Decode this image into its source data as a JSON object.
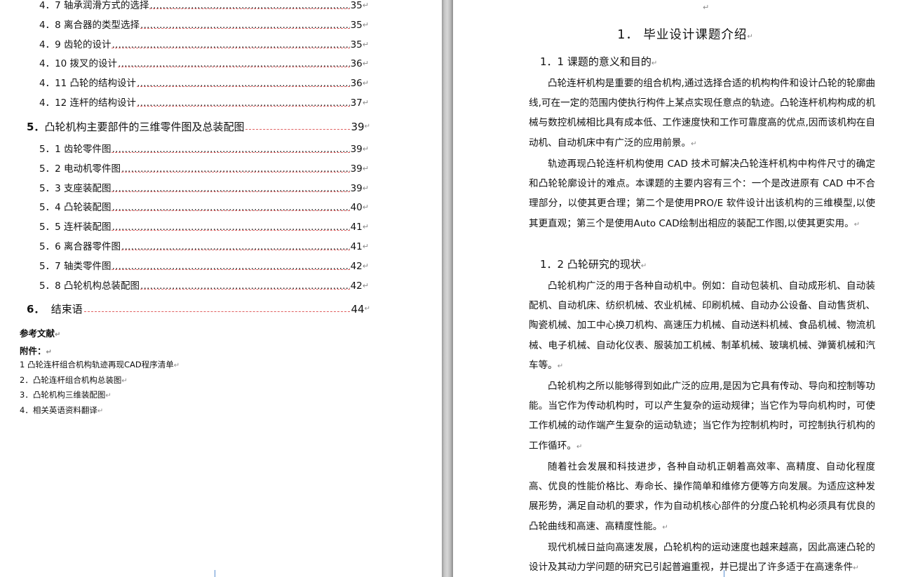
{
  "left_page": {
    "toc_items": [
      {
        "label": "4．7 轴承润滑方式的选择",
        "page": "35"
      },
      {
        "label": "4．8 离合器的类型选择",
        "page": "35"
      },
      {
        "label": "4．9 齿轮的设计",
        "page": "35"
      },
      {
        "label": "4．10 拨叉的设计",
        "page": "36"
      },
      {
        "label": "4．11 凸轮的结构设计",
        "page": "36"
      },
      {
        "label": "4．12 连杆的结构设计",
        "page": "37"
      }
    ],
    "chapter5": {
      "number": "5．",
      "title": "凸轮机构主要部件的三维零件图及总装配图",
      "page": "39"
    },
    "chapter5_items": [
      {
        "label": "5．1 齿轮零件图",
        "page": "39"
      },
      {
        "label": "5．2 电动机零件图",
        "page": "39"
      },
      {
        "label": "5．3 支座装配图",
        "page": "39"
      },
      {
        "label": "5．4 凸轮装配图",
        "page": "40"
      },
      {
        "label": "5．5 连杆装配图",
        "page": "41"
      },
      {
        "label": "5．6 离合器零件图",
        "page": "41"
      },
      {
        "label": "5．7 轴类零件图",
        "page": "42"
      },
      {
        "label": "5．8 凸轮机构总装配图",
        "page": "42"
      }
    ],
    "chapter6": {
      "number": "6．",
      "title": "结束语",
      "page": "44"
    },
    "references": "参考文献",
    "attachments_label": "附件：",
    "attachments": [
      "1 凸轮连杆组合机构轨迹再现CAD程序清单",
      "2．凸轮连杆组合机构总装图",
      "3．凸轮机构三维装配图",
      "4．相关英语资料翻译"
    ],
    "dots": "……………………………………………………………………………………"
  },
  "right_page": {
    "chapter_title": "1． 毕业设计课题介绍",
    "section1": "1．1 课题的意义和目的",
    "section1_paras": [
      "凸轮连杆机构是重要的组合机构,通过选择合适的机构构件和设计凸轮的轮廓曲线,可在一定的范围内使执行构件上某点实现任意点的轨迹。凸轮连杆机构构成的机械与数控机械相比具有成本低、工作速度快和工作可靠度高的优点,因而该机构在自动机、自动机床中有广泛的应用前景。",
      "轨迹再现凸轮连杆机构使用 CAD 技术可解决凸轮连杆机构中构件尺寸的确定和凸轮轮廓设计的难点。本课题的主要内容有三个：一个是改进原有 CAD 中不合理部分，以使其更合理；第二个是使用PRO/E 软件设计出该机构的三维模型,以使其更直观；第三个是使用Auto CAD绘制出相应的装配工作图,以使其更实用。"
    ],
    "section2": "1．2 凸轮研究的现状",
    "section2_paras": [
      "凸轮机构广泛的用于各种自动机中。例如：自动包装机、自动成形机、自动装配机、自动机床、纺织机械、农业机械、印刷机械、自动办公设备、自动售货机、陶瓷机械、加工中心换刀机构、高速压力机械、自动送料机械、食品机械、物流机械、电子机械、自动化仪表、服装加工机械、制革机械、玻璃机械、弹簧机械和汽车等。",
      "凸轮机构之所以能够得到如此广泛的应用,是因为它具有传动、导向和控制等功能。当它作为传动机构时，可以产生复杂的运动规律；当它作为导向机构时，可使工作机械的动作端产生复杂的运动轨迹；当它作为控制机构时，可控制执行机构的工作循环。",
      "随着社会发展和科技进步，各种自动机正朝着高效率、高精度、自动化程度高、优良的性能价格比、寿命长、操作简单和维修方便等方向发展。为适应这种发展形势，满足自动机的要求，作为自动机核心部件的分度凸轮机构必须具有优良的凸轮曲线和高速、高精度性能。",
      "现代机械日益向高速发展，凸轮机构的运动速度也越来越高，因此高速凸轮的设计及其动力学问题的研究已引起普遍重视，并已提出了许多适于在高速条件"
    ]
  }
}
